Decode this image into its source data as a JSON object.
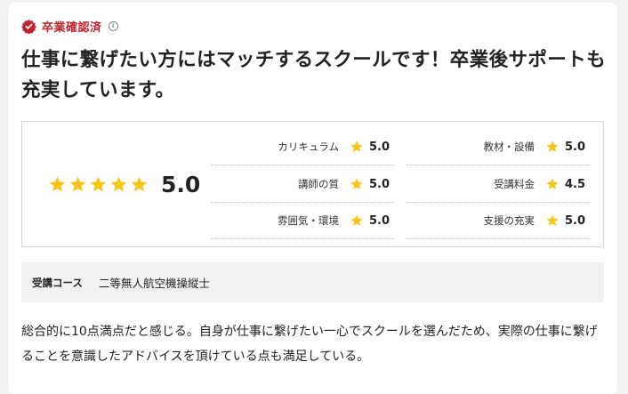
{
  "badge": {
    "label": "卒業確認済",
    "info_icon": "info-icon",
    "icon": "check-badge-icon",
    "color": "#c0232c"
  },
  "title": "仕事に繋げたい方にはマッチするスクールです！卒業後サポートも充実しています。",
  "rating": {
    "overall": {
      "stars": 5,
      "score": "5.0"
    },
    "categories": [
      {
        "label": "カリキュラム",
        "score": "5.0"
      },
      {
        "label": "教材・設備",
        "score": "5.0"
      },
      {
        "label": "講師の質",
        "score": "5.0"
      },
      {
        "label": "受講料金",
        "score": "4.5"
      },
      {
        "label": "雰囲気・環境",
        "score": "5.0"
      },
      {
        "label": "支援の充実",
        "score": "5.0"
      }
    ],
    "star_color": "#f5c518"
  },
  "course": {
    "label": "受講コース",
    "name": "二等無人航空機操縦士"
  },
  "review_text": "総合的に10点満点だと感じる。自身が仕事に繋げたい一心でスクールを選んだため、実際の仕事に繋げることを意識したアドバイスを頂けている点も満足している。"
}
